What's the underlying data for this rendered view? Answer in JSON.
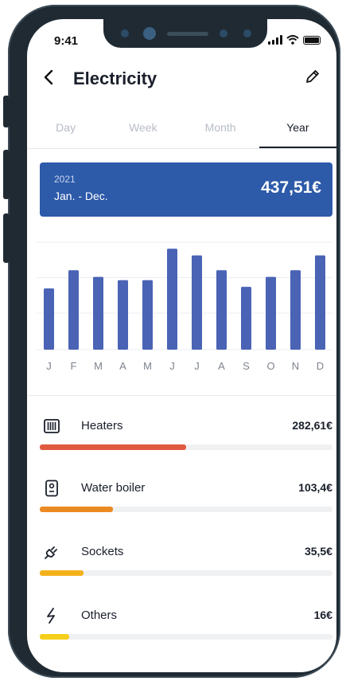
{
  "status": {
    "time": "9:41"
  },
  "header": {
    "title": "Electricity",
    "back_icon": "chevron-left-icon",
    "edit_icon": "pencil-icon"
  },
  "tabs": [
    {
      "label": "Day",
      "active": false
    },
    {
      "label": "Week",
      "active": false
    },
    {
      "label": "Month",
      "active": false
    },
    {
      "label": "Year",
      "active": true
    }
  ],
  "summary": {
    "year": "2021",
    "range": "Jan. - Dec.",
    "total": "437,51€",
    "color": "#2d5aa9"
  },
  "chart_data": {
    "type": "bar",
    "categories": [
      "J",
      "F",
      "M",
      "A",
      "M",
      "J",
      "J",
      "A",
      "S",
      "O",
      "N",
      "D"
    ],
    "values": [
      37,
      48,
      44,
      42,
      42,
      61,
      57,
      48,
      38,
      44,
      48,
      57
    ],
    "ylim": [
      0,
      65
    ],
    "grid": true,
    "color": "#4a63b5"
  },
  "categories": [
    {
      "name": "Heaters",
      "amount": "282,61€",
      "share": 0.5,
      "color": "#e05a3f",
      "icon": "radiator-icon"
    },
    {
      "name": "Water boiler",
      "amount": "103,4€",
      "share": 0.25,
      "color": "#eb8a22",
      "icon": "boiler-icon"
    },
    {
      "name": "Sockets",
      "amount": "35,5€",
      "share": 0.15,
      "color": "#f2b11b",
      "icon": "plug-icon"
    },
    {
      "name": "Others",
      "amount": "16€",
      "share": 0.1,
      "color": "#f6cf1c",
      "icon": "lightning-icon"
    }
  ]
}
